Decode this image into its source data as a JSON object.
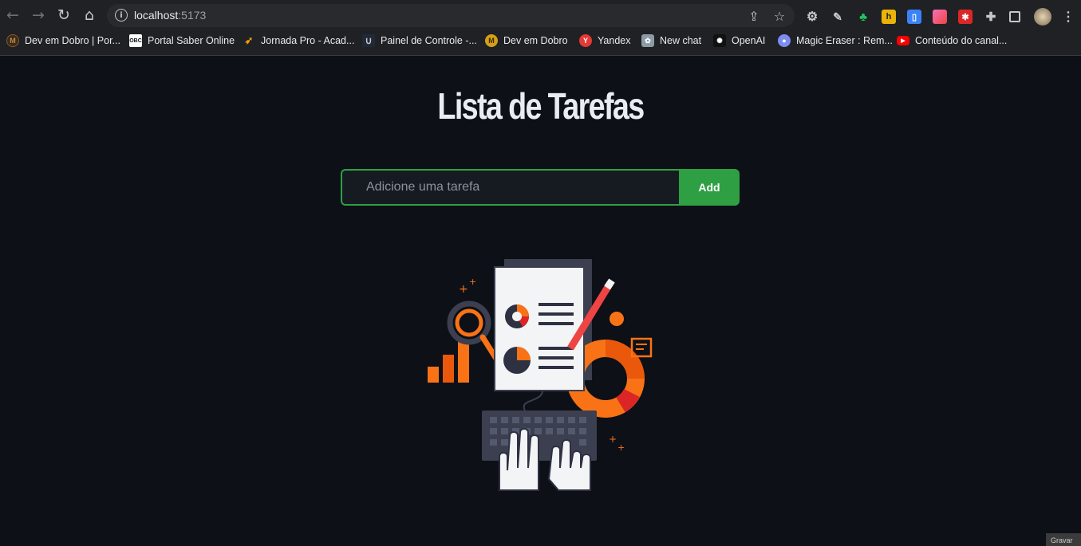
{
  "browser": {
    "url_host": "localhost",
    "url_port": ":5173",
    "bookmarks": [
      {
        "label": "Dev em Dobro | Por...",
        "icon": "devemdobro-icon",
        "color": "#8a5a2b"
      },
      {
        "label": "Portal Saber Online",
        "icon": "portal-icon",
        "color": "#ffffff"
      },
      {
        "label": "Jornada Pro - Acad...",
        "icon": "jornada-icon",
        "color": "#f59e0b"
      },
      {
        "label": "Painel de Controle -...",
        "icon": "painel-icon",
        "color": "#1f2937"
      },
      {
        "label": "Dev em Dobro",
        "icon": "devemdobro-m-icon",
        "color": "#d4a017"
      },
      {
        "label": "Yandex",
        "icon": "yandex-icon",
        "color": "#e53935"
      },
      {
        "label": "New chat",
        "icon": "chat-icon",
        "color": "#8e9aa6"
      },
      {
        "label": "OpenAI",
        "icon": "openai-icon",
        "color": "#111111"
      },
      {
        "label": "Magic Eraser : Rem...",
        "icon": "magic-eraser-icon",
        "color": "#7c8cf0"
      },
      {
        "label": "Conteúdo do canal...",
        "icon": "youtube-icon",
        "color": "#ff0000"
      }
    ],
    "recording_tab": "Gravar"
  },
  "app": {
    "title": "Lista de Tarefas",
    "input_placeholder": "Adicione uma tarefa",
    "input_value": "",
    "add_label": "Add",
    "accent": "#2ea043"
  }
}
